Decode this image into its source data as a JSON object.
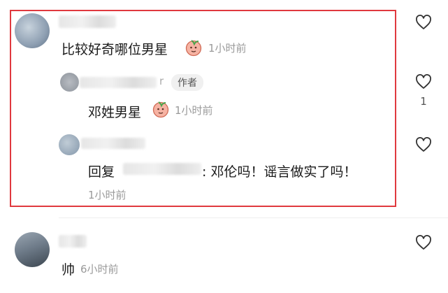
{
  "comments": [
    {
      "text": "比较好奇哪位男星",
      "time": "1小时前",
      "replies": [
        {
          "username_tail": "r",
          "badge": "作者",
          "text": "邓姓男星",
          "time": "1小时前",
          "likes": "1"
        },
        {
          "reply_prefix": "回复",
          "reply_text": ": 邓伦吗！谣言做实了吗！",
          "time": "1小时前"
        }
      ]
    },
    {
      "text": "帅",
      "time": "6小时前"
    }
  ],
  "colors": {
    "highlight_border": "#e0393e",
    "time_gray": "#9a9a9a",
    "badge_bg": "#f0f0f0"
  },
  "icons": {
    "like": "heart-outline-icon",
    "emoji": "peach-face-emoji-icon"
  }
}
